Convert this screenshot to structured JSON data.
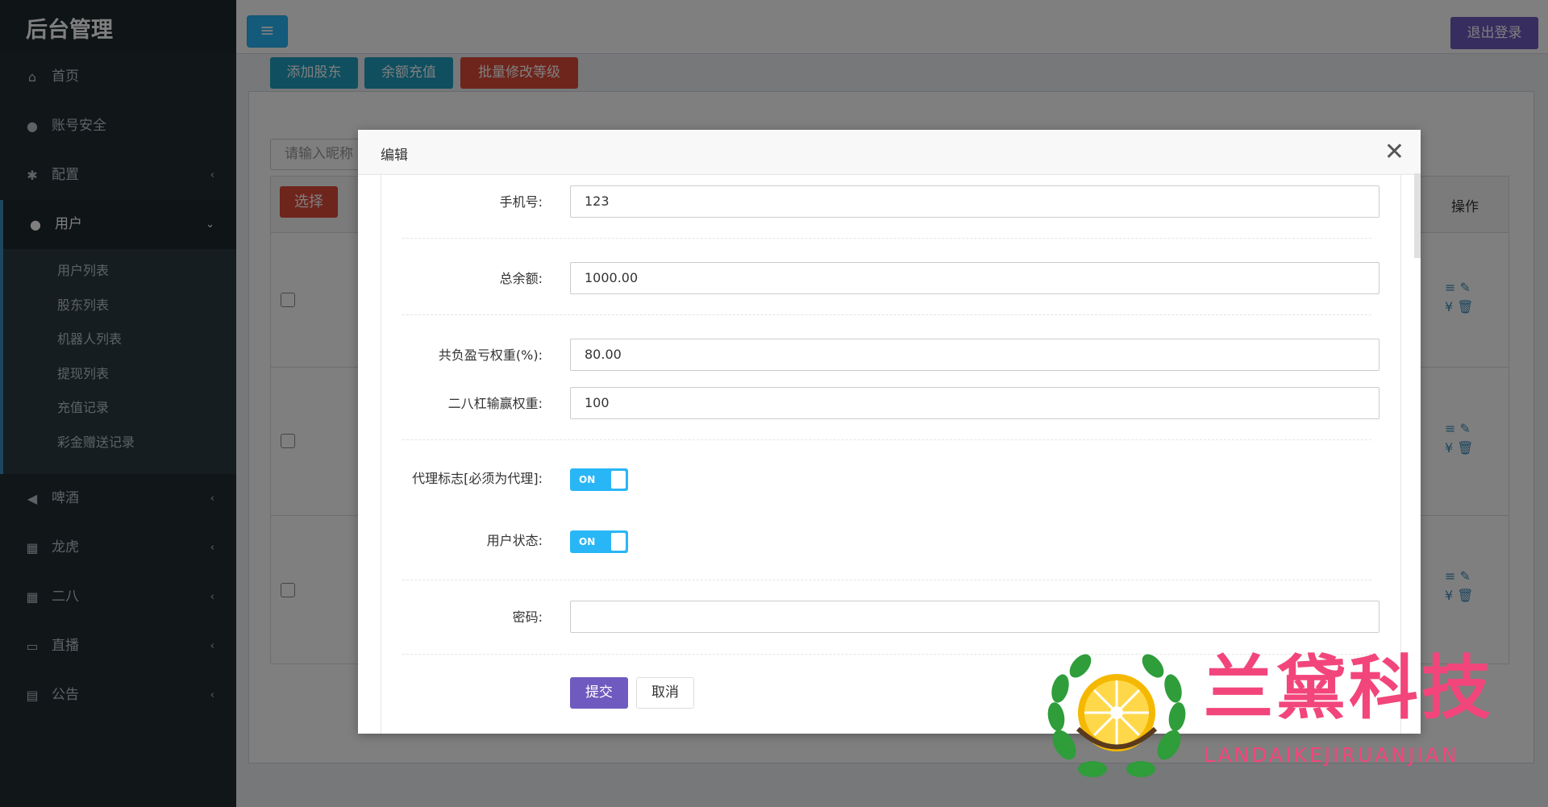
{
  "app": {
    "title": "后台管理"
  },
  "sidebar": {
    "items": [
      {
        "label": "首页",
        "icon": "home-icon"
      },
      {
        "label": "账号安全",
        "icon": "user-icon"
      },
      {
        "label": "配置",
        "icon": "gear-icon"
      },
      {
        "label": "用户",
        "icon": "users-icon"
      },
      {
        "label": "啤酒",
        "icon": "bullhorn-icon"
      },
      {
        "label": "龙虎",
        "icon": "grid-icon"
      },
      {
        "label": "二八",
        "icon": "grid-icon"
      },
      {
        "label": "直播",
        "icon": "monitor-icon"
      },
      {
        "label": "公告",
        "icon": "list-icon"
      }
    ],
    "submenu": [
      "用户列表",
      "股东列表",
      "机器人列表",
      "提现列表",
      "充值记录",
      "彩金赠送记录"
    ]
  },
  "topbar": {
    "logout": "退出登录"
  },
  "actions": {
    "add_shareholder": "添加股东",
    "recharge": "余额充值",
    "batch_level": "批量修改等级"
  },
  "search": {
    "placeholder": "请输入昵称"
  },
  "table": {
    "select_label": "选择",
    "ops_header": "操作"
  },
  "modal": {
    "title": "编辑",
    "fields": {
      "phone": {
        "label": "手机号:",
        "value": "123"
      },
      "balance": {
        "label": "总余额:",
        "value": "1000.00"
      },
      "profit_weight": {
        "label": "共负盈亏权重(%):",
        "value": "80.00"
      },
      "erba_weight": {
        "label": "二八杠输赢权重:",
        "value": "100"
      },
      "agent_flag": {
        "label": "代理标志[必须为代理]:",
        "value": "ON"
      },
      "user_status": {
        "label": "用户状态:",
        "value": "ON"
      },
      "password": {
        "label": "密码:",
        "value": ""
      }
    },
    "submit": "提交",
    "cancel": "取消"
  },
  "watermark": {
    "title": "兰黛科技",
    "subtitle": "LANDAIKEJIRUANJIAN"
  },
  "colors": {
    "sidebar": "#222d32",
    "accent_blue": "#29b6f6",
    "purple": "#6f5bbf",
    "red": "#dd4b39",
    "teal": "#1f9fc1"
  }
}
